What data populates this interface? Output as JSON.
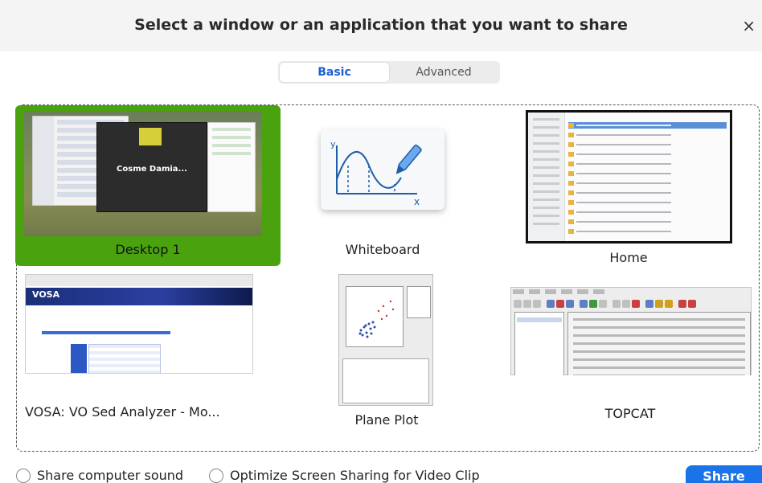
{
  "dialog": {
    "title": "Select a window or an application that you want to share",
    "close_glyph": "×"
  },
  "tabs": [
    {
      "label": "Basic",
      "active": true
    },
    {
      "label": "Advanced",
      "active": false
    }
  ],
  "tiles": [
    {
      "label": "Desktop 1",
      "selected": true,
      "thumb_text": "Cosme Damia..."
    },
    {
      "label": "Whiteboard",
      "selected": false
    },
    {
      "label": "Home",
      "selected": false
    },
    {
      "label": "VOSA: VO Sed Analyzer - Mo...",
      "selected": false,
      "thumb_text": "VOSA"
    },
    {
      "label": "Plane Plot",
      "selected": false
    },
    {
      "label": "TOPCAT",
      "selected": false
    }
  ],
  "options": {
    "share_sound": {
      "label": "Share computer sound",
      "checked": false
    },
    "optimize_video": {
      "label": "Optimize Screen Sharing for Video Clip",
      "checked": false
    }
  },
  "share_button": {
    "label": "Share"
  },
  "colors": {
    "selected_tile": "#4aa30e",
    "accent": "#1a73e8"
  },
  "icons": {
    "close": "close-icon",
    "whiteboard": "whiteboard-graph-icon"
  }
}
